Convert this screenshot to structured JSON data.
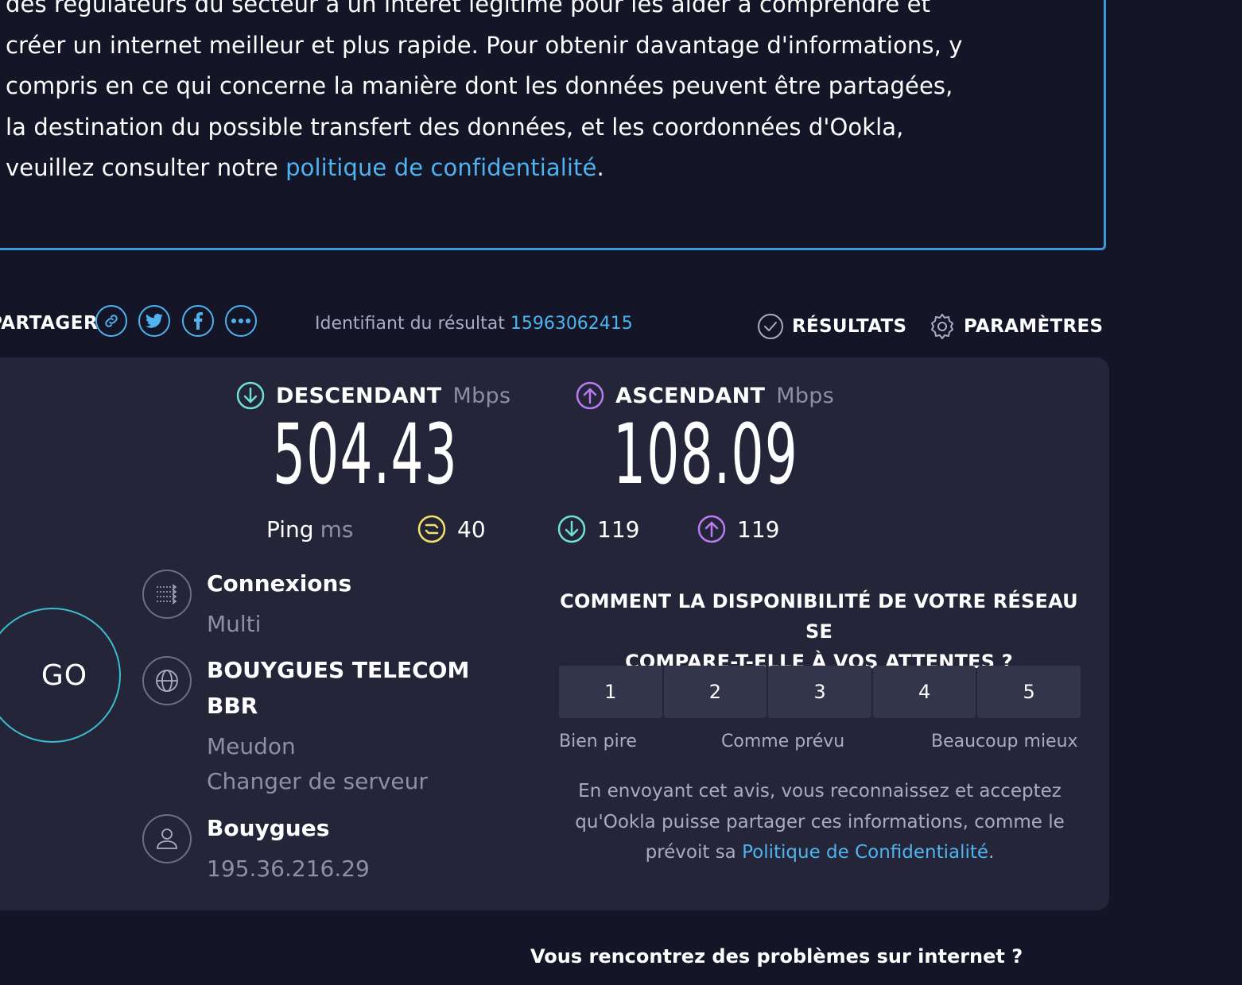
{
  "consent": {
    "line1": "des régulateurs du secteur a un intérêt légitime pour les aider à comprendre et",
    "line2": "créer un internet meilleur et plus rapide. Pour obtenir davantage d'informations, y",
    "line3": "compris en ce qui concerne la manière dont les données peuvent être partagées,",
    "line4": "la destination du possible transfert des données, et les coordonnées d'Ookla,",
    "line5_prefix": "veuillez consulter notre ",
    "line5_link": "politique de confidentialité",
    "line5_suffix": "."
  },
  "share": {
    "label": "PARTAGER",
    "buttons": [
      "link-icon",
      "twitter-icon",
      "facebook-icon",
      "more-icon"
    ]
  },
  "result": {
    "id_label": "Identifiant du résultat",
    "id_value": "15963062415"
  },
  "nav": {
    "results": "RÉSULTATS",
    "settings": "PARAMÈTRES"
  },
  "download": {
    "label": "DESCENDANT",
    "unit": "Mbps",
    "value": "504.43",
    "color": "#6fe0d6"
  },
  "upload": {
    "label": "ASCENDANT",
    "unit": "Mbps",
    "value": "108.09",
    "color": "#b97cf0"
  },
  "ping": {
    "label": "Ping",
    "unit": "ms",
    "idle": "40",
    "down": "119",
    "up": "119",
    "idle_color": "#f5e26b"
  },
  "go": {
    "label": "GO"
  },
  "connections": {
    "title": "Connexions",
    "value": "Multi"
  },
  "server": {
    "title_line1": "BOUYGUES TELECOM",
    "title_line2": "BBR",
    "location": "Meudon",
    "change_link": "Changer de serveur"
  },
  "provider": {
    "name": "Bouygues",
    "ip": "195.36.216.29"
  },
  "survey": {
    "question_line1": "COMMENT LA DISPONIBILITÉ DE VOTRE RÉSEAU SE",
    "question_line2": "COMPARE-T-ELLE À VOS ATTENTES ?",
    "options": [
      "1",
      "2",
      "3",
      "4",
      "5"
    ],
    "label_low": "Bien pire",
    "label_mid": "Comme prévu",
    "label_high": "Beaucoup mieux",
    "disclaimer_line1": "En envoyant cet avis, vous reconnaissez et acceptez",
    "disclaimer_line2": "qu'Ookla puisse partager ces informations, comme le",
    "disclaimer_prefix": "prévoit sa ",
    "disclaimer_link": "Politique de Confidentialité",
    "disclaimer_suffix": "."
  },
  "trouble": {
    "heading": "Vous rencontrez des problèmes sur internet ?"
  }
}
